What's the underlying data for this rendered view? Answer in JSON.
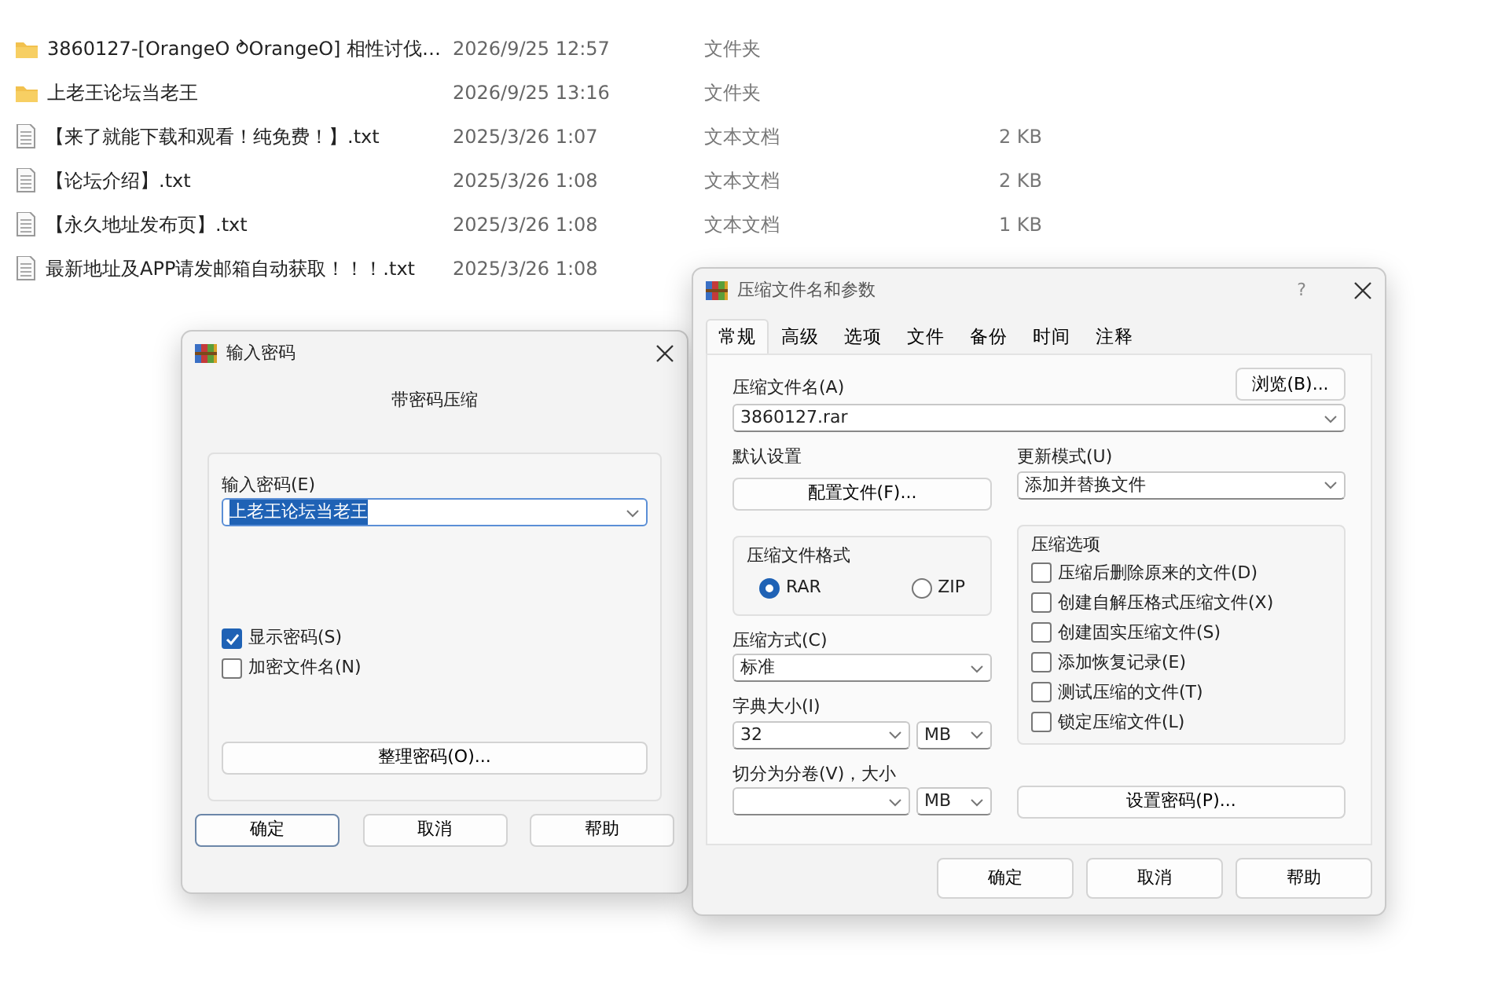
{
  "files": [
    {
      "kind": "folder",
      "name": "3860127-[OrangeO  ⥁OrangeO] 相性讨伐…",
      "date": "2026/9/25 12:57",
      "type": "文件夹"
    },
    {
      "kind": "folder",
      "name": "上老王论坛当老王",
      "date": "2026/9/25 13:16",
      "type": "文件夹"
    },
    {
      "kind": "text",
      "name": "【来了就能下载和观看！纯免费！】.txt",
      "date": "2025/3/26 1:07",
      "type": "文本文档",
      "size": "2 KB"
    },
    {
      "kind": "text",
      "name": "【论坛介绍】.txt",
      "date": "2025/3/26 1:08",
      "type": "文本文档",
      "size": "2 KB"
    },
    {
      "kind": "text",
      "name": "【永久地址发布页】.txt",
      "date": "2025/3/26 1:08",
      "type": "文本文档",
      "size": "1 KB"
    },
    {
      "kind": "text",
      "name": "最新地址及APP请发邮箱自动获取！！！.txt",
      "date": "2025/3/26 1:08"
    }
  ],
  "password_dialog": {
    "title": "输入密码",
    "heading": "带密码压缩",
    "field_label": "输入密码(E)",
    "password_value": "上老王论坛当老王",
    "value_selected": true,
    "checkboxes": [
      {
        "label": "显示密码(S)",
        "checked": true
      },
      {
        "label": "加密文件名(N)",
        "checked": false
      }
    ],
    "manage_button": "整理密码(O)...",
    "buttons": [
      {
        "label": "确定",
        "default": true
      },
      {
        "label": "取消",
        "default": false
      },
      {
        "label": "帮助",
        "default": false
      }
    ]
  },
  "archive_dialog": {
    "title": "压缩文件名和参数",
    "help_button": "?",
    "tabs": [
      {
        "label": "常规",
        "selected": true
      },
      {
        "label": "高级",
        "selected": false
      },
      {
        "label": "选项",
        "selected": false
      },
      {
        "label": "文件",
        "selected": false
      },
      {
        "label": "备份",
        "selected": false
      },
      {
        "label": "时间",
        "selected": false
      },
      {
        "label": "注释",
        "selected": false
      }
    ],
    "archive_name_label": "压缩文件名(A)",
    "browse_button": "浏览(B)...",
    "archive_name": "3860127.rar",
    "default_settings_label": "默认设置",
    "profiles_button": "配置文件(F)...",
    "update_mode_label": "更新模式(U)",
    "update_mode": "添加并替换文件",
    "format_label": "压缩文件格式",
    "formats": [
      {
        "label": "RAR",
        "selected": true
      },
      {
        "label": "ZIP",
        "selected": false
      }
    ],
    "options_label": "压缩选项",
    "options": [
      {
        "label": "压缩后删除原来的文件(D)",
        "checked": false
      },
      {
        "label": "创建自解压格式压缩文件(X)",
        "checked": false
      },
      {
        "label": "创建固实压缩文件(S)",
        "checked": false
      },
      {
        "label": "添加恢复记录(E)",
        "checked": false
      },
      {
        "label": "测试压缩的文件(T)",
        "checked": false
      },
      {
        "label": "锁定压缩文件(L)",
        "checked": false
      }
    ],
    "method_label": "压缩方式(C)",
    "method": "标准",
    "dict_label": "字典大小(I)",
    "dict_size": "32",
    "dict_unit": "MB",
    "split_label": "切分为分卷(V)，大小",
    "split_unit": "MB",
    "password_button": "设置密码(P)...",
    "buttons": [
      {
        "label": "确定"
      },
      {
        "label": "取消"
      },
      {
        "label": "帮助"
      }
    ]
  }
}
